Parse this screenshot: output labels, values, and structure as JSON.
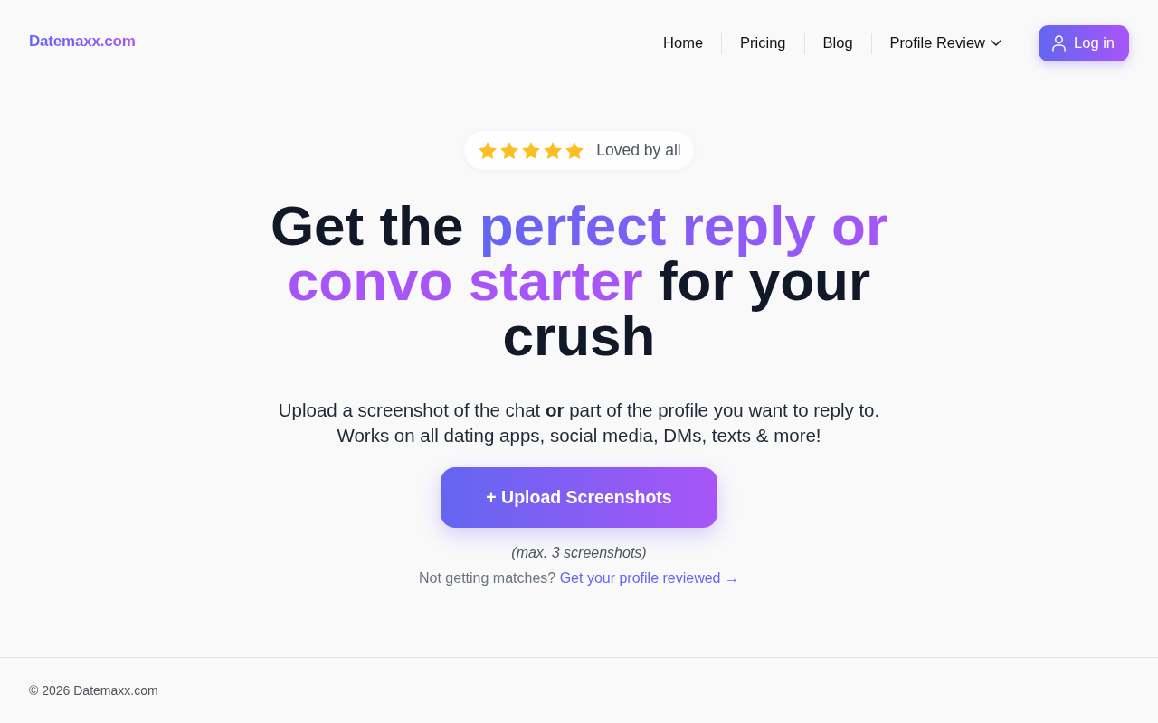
{
  "header": {
    "logo": "Datemaxx.com",
    "nav": [
      {
        "label": "Home",
        "kind": "link"
      },
      {
        "label": "Pricing",
        "kind": "link"
      },
      {
        "label": "Blog",
        "kind": "link"
      },
      {
        "label": "Profile Review",
        "kind": "dropdown"
      }
    ],
    "login_button": "Log in"
  },
  "hero": {
    "rating": {
      "stars": 5,
      "label": "Loved by all"
    },
    "headline": [
      {
        "text": "Get the ",
        "highlight": false
      },
      {
        "text": "perfect reply or convo starter",
        "highlight": true
      },
      {
        "text": " for your crush",
        "highlight": false
      }
    ],
    "description": [
      "Upload a screenshot of the chat **or** part of the profile you want to reply to.",
      "Works on all dating apps, social media, DMs, texts & more!"
    ],
    "upload_button": "+ Upload Screenshots",
    "upload_note": "(max. 3 screenshots)",
    "review_prompt": {
      "text": "Not getting matches?",
      "link": "Get your profile reviewed →"
    }
  },
  "footer": {
    "copyright": "© 2026 Datemaxx.com"
  }
}
